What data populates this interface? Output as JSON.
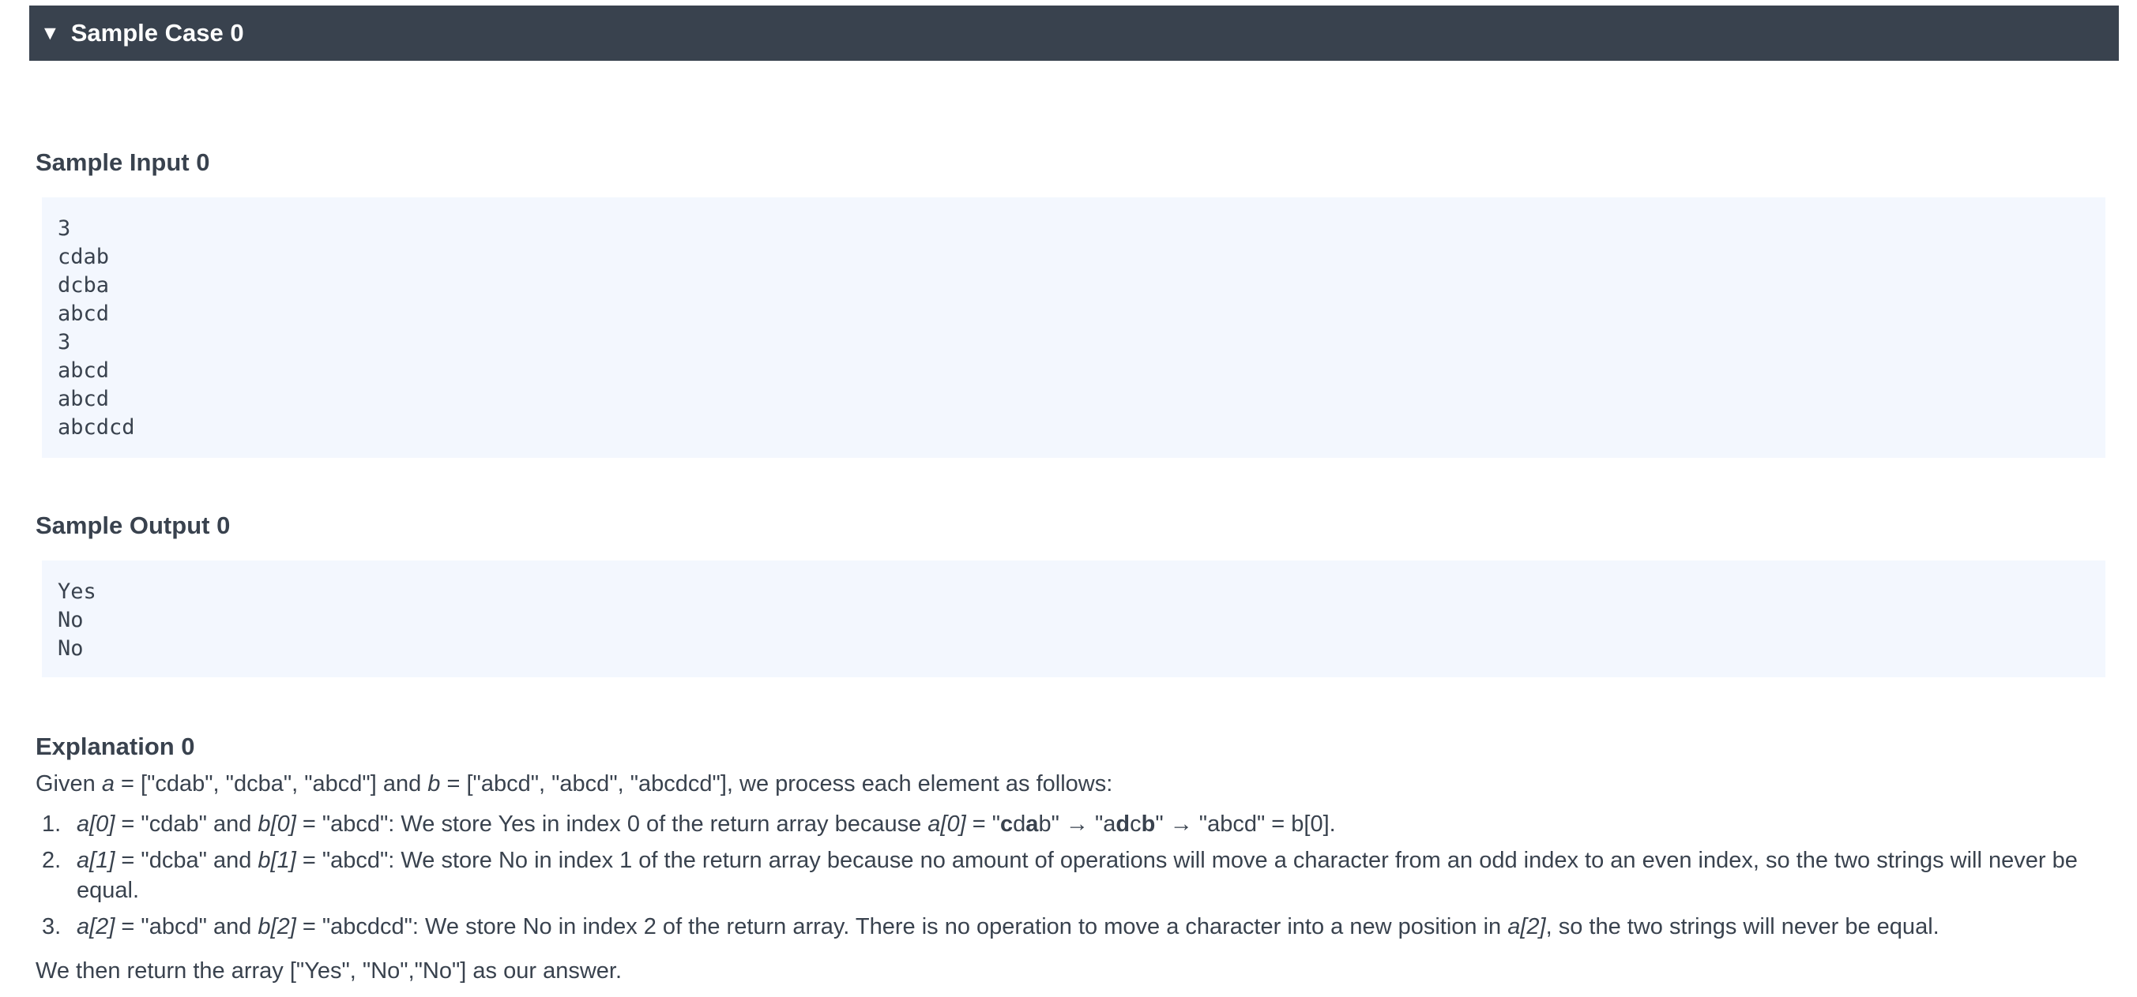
{
  "header": {
    "toggle_icon": "triangle-down-icon",
    "title": "Sample Case 0"
  },
  "sample_input": {
    "title": "Sample Input 0",
    "lines": [
      "3",
      "cdab",
      "dcba",
      "abcd",
      "3",
      "abcd",
      "abcd",
      "abcdcd"
    ]
  },
  "sample_output": {
    "title": "Sample Output 0",
    "lines": [
      "Yes",
      "No",
      "No"
    ]
  },
  "explanation": {
    "title": "Explanation 0",
    "intro": {
      "t1": "Given ",
      "a": "a",
      "t2": " = [\"cdab\", \"dcba\", \"abcd\"] and ",
      "b": "b",
      "t3": " = [\"abcd\", \"abcd\", \"abcdcd\"], we process each element as follows:"
    },
    "items": [
      {
        "num": "1.",
        "a": "a[0]",
        "t1": " = \"cdab\" and ",
        "b": "b[0]",
        "t2": " = \"abcd\": We store Yes in index 0 of the return array because ",
        "a2": "a[0]",
        "t3": " = \"",
        "s1_bold1": "c",
        "s1_plain1": "d",
        "s1_bold2": "a",
        "s1_plain2": "b",
        "t4": "\" → \"a",
        "s2_bold1": "d",
        "s2_plain1": "c",
        "s2_bold2": "b",
        "t5": "\" → \"abcd\" = b[0]."
      },
      {
        "num": "2.",
        "a": "a[1]",
        "t1": " = \"dcba\" and ",
        "b": "b[1]",
        "t2": " = \"abcd\": We store No in index 1 of the return array because no amount of operations will move a character from an odd index to an even index, so the two strings will never be equal."
      },
      {
        "num": "3.",
        "a": "a[2]",
        "t1": " = \"abcd\" and ",
        "b": "b[2]",
        "t2": " = \"abcdcd\": We store No in index 2 of the return array.  There is no operation to move a character into a new position in ",
        "a2": "a[2]",
        "t3": ", so the two strings will never be equal."
      }
    ],
    "conclusion": "We then return the array [\"Yes\", \"No\",\"No\"] as our answer."
  }
}
